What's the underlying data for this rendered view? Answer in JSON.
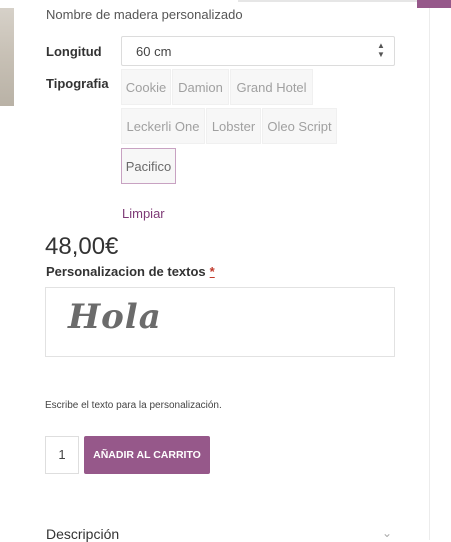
{
  "product": {
    "subtitle": "Nombre de madera personalizado",
    "price": "48,00€"
  },
  "attributes": {
    "length": {
      "label": "Longitud",
      "value": "60 cm"
    },
    "typography": {
      "label": "Tipografia",
      "options": [
        "Cookie",
        "Damion",
        "Grand Hotel",
        "Leckerli One",
        "Lobster",
        "Oleo Script",
        "Pacifico"
      ],
      "selected": "Pacifico"
    },
    "clear_label": "Limpiar"
  },
  "personalization": {
    "label": "Personalizacion de textos",
    "required_mark": "*",
    "preview_text": "Hola",
    "help_text": "Escribe el texto para la personalización."
  },
  "cart": {
    "quantity": "1",
    "add_label": "AÑADIR AL CARRITO"
  },
  "accordion": {
    "description_label": "Descripción"
  },
  "colors": {
    "accent": "#96588a",
    "link": "#7e3a76",
    "selected_border": "#c8a2c2"
  },
  "icons": {
    "select_arrows": "up-down-arrows-icon",
    "accordion": "chevron-down-icon"
  }
}
